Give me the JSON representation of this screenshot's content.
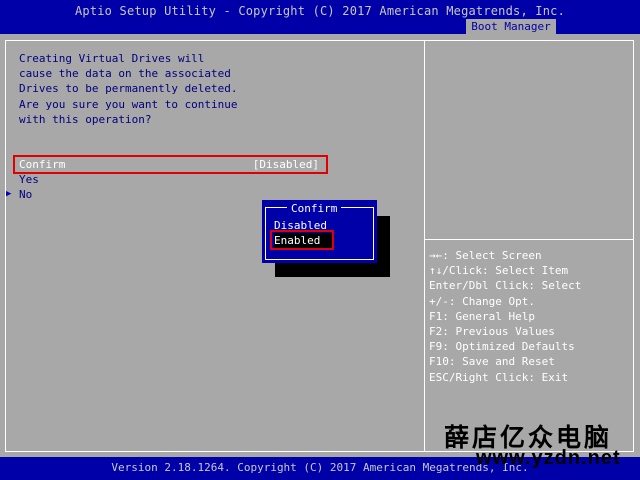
{
  "header": {
    "title": "Aptio Setup Utility - Copyright (C) 2017 American Megatrends, Inc.",
    "active_tab": "Boot Manager"
  },
  "warning_lines": [
    "Creating Virtual Drives will",
    "cause the data on the associated",
    "Drives to be permanently deleted.",
    "Are you sure you want to continue",
    "with this operation?"
  ],
  "menu": {
    "confirm_label": "Confirm",
    "confirm_value": "[Disabled]",
    "yes_label": "Yes",
    "no_label": "No",
    "pointer_icon": "triangle-right"
  },
  "popup": {
    "title": "Confirm",
    "options": [
      "Disabled",
      "Enabled"
    ],
    "highlighted": "Enabled"
  },
  "help_lines": [
    "→←: Select Screen",
    "↑↓/Click: Select Item",
    "Enter/Dbl Click: Select",
    "+/-: Change Opt.",
    "F1: General Help",
    "F2: Previous Values",
    "F9: Optimized Defaults",
    "F10: Save and Reset",
    "ESC/Right Click: Exit"
  ],
  "footer": {
    "version": "Version 2.18.1264. Copyright (C) 2017 American Megatrends, Inc."
  },
  "watermark": {
    "chinese": "薛店亿众电脑",
    "url": "www.yzdn.net"
  },
  "colors": {
    "bios_blue": "#0000a8",
    "panel_gray": "#a8a8a8",
    "highlight_red": "#e00000"
  }
}
